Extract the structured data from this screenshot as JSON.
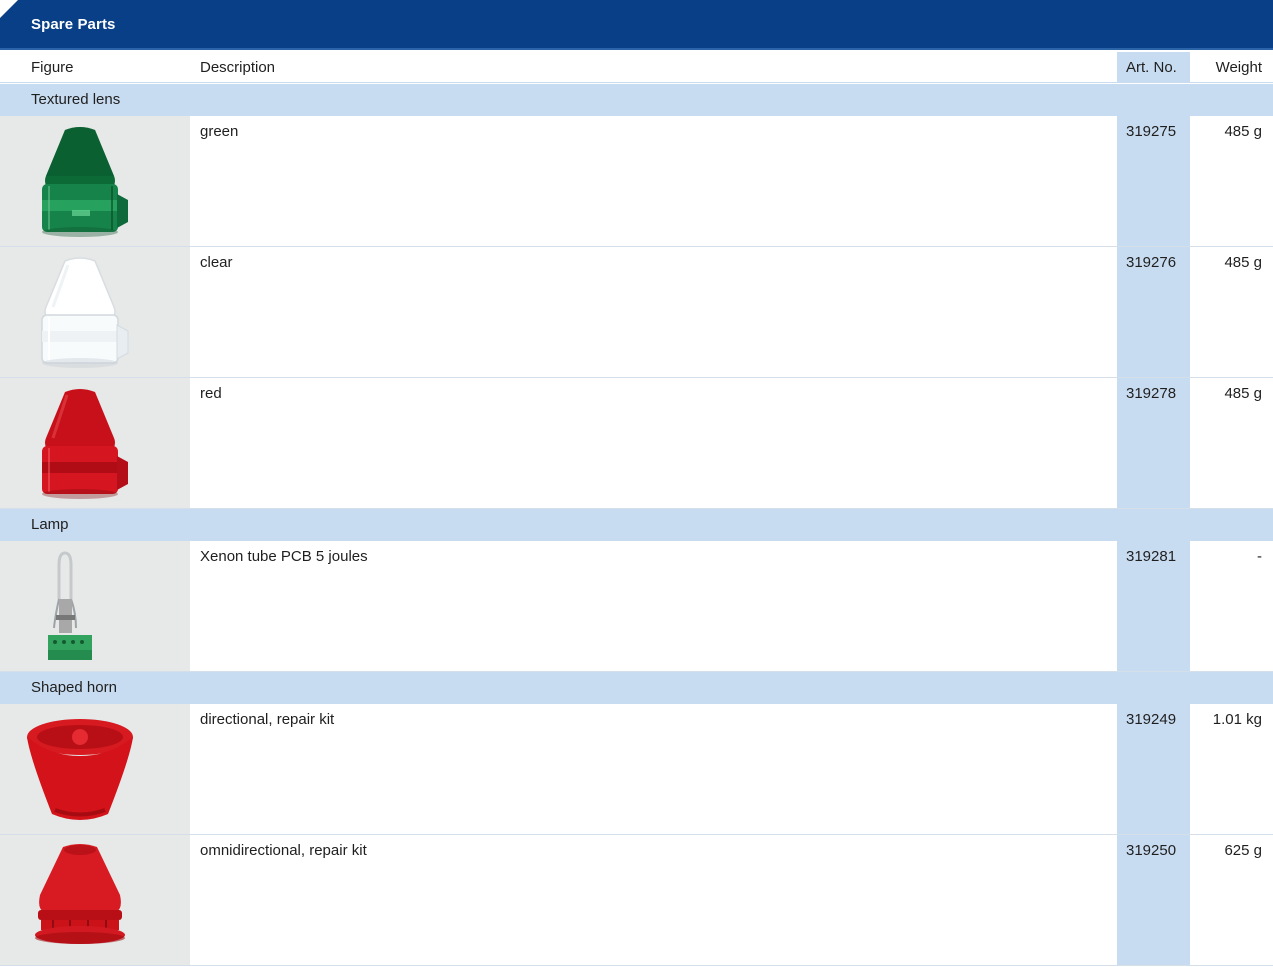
{
  "title": "Spare Parts",
  "headers": {
    "figure": "Figure",
    "description": "Description",
    "art_no": "Art. No.",
    "weight": "Weight"
  },
  "groups": [
    {
      "label": "Textured lens",
      "items": [
        {
          "description": "green",
          "art_no": "319275",
          "weight": "485 g",
          "figure": "green-lens-icon"
        },
        {
          "description": "clear",
          "art_no": "319276",
          "weight": "485 g",
          "figure": "clear-lens-icon"
        },
        {
          "description": "red",
          "art_no": "319278",
          "weight": "485 g",
          "figure": "red-lens-icon"
        }
      ]
    },
    {
      "label": "Lamp",
      "items": [
        {
          "description": "Xenon tube PCB 5 joules",
          "art_no": "319281",
          "weight": "-",
          "figure": "xenon-tube-icon"
        }
      ]
    },
    {
      "label": "Shaped horn",
      "items": [
        {
          "description": "directional, repair kit",
          "art_no": "319249",
          "weight": "1.01 kg",
          "figure": "directional-horn-icon"
        },
        {
          "description": "omnidirectional, repair kit",
          "art_no": "319250",
          "weight": "625 g",
          "figure": "omnidirectional-horn-icon"
        }
      ]
    }
  ],
  "colors": {
    "title_bar": "#093f86",
    "row_highlight": "#c8dcf1",
    "figure_background": "#e7e8e8"
  }
}
